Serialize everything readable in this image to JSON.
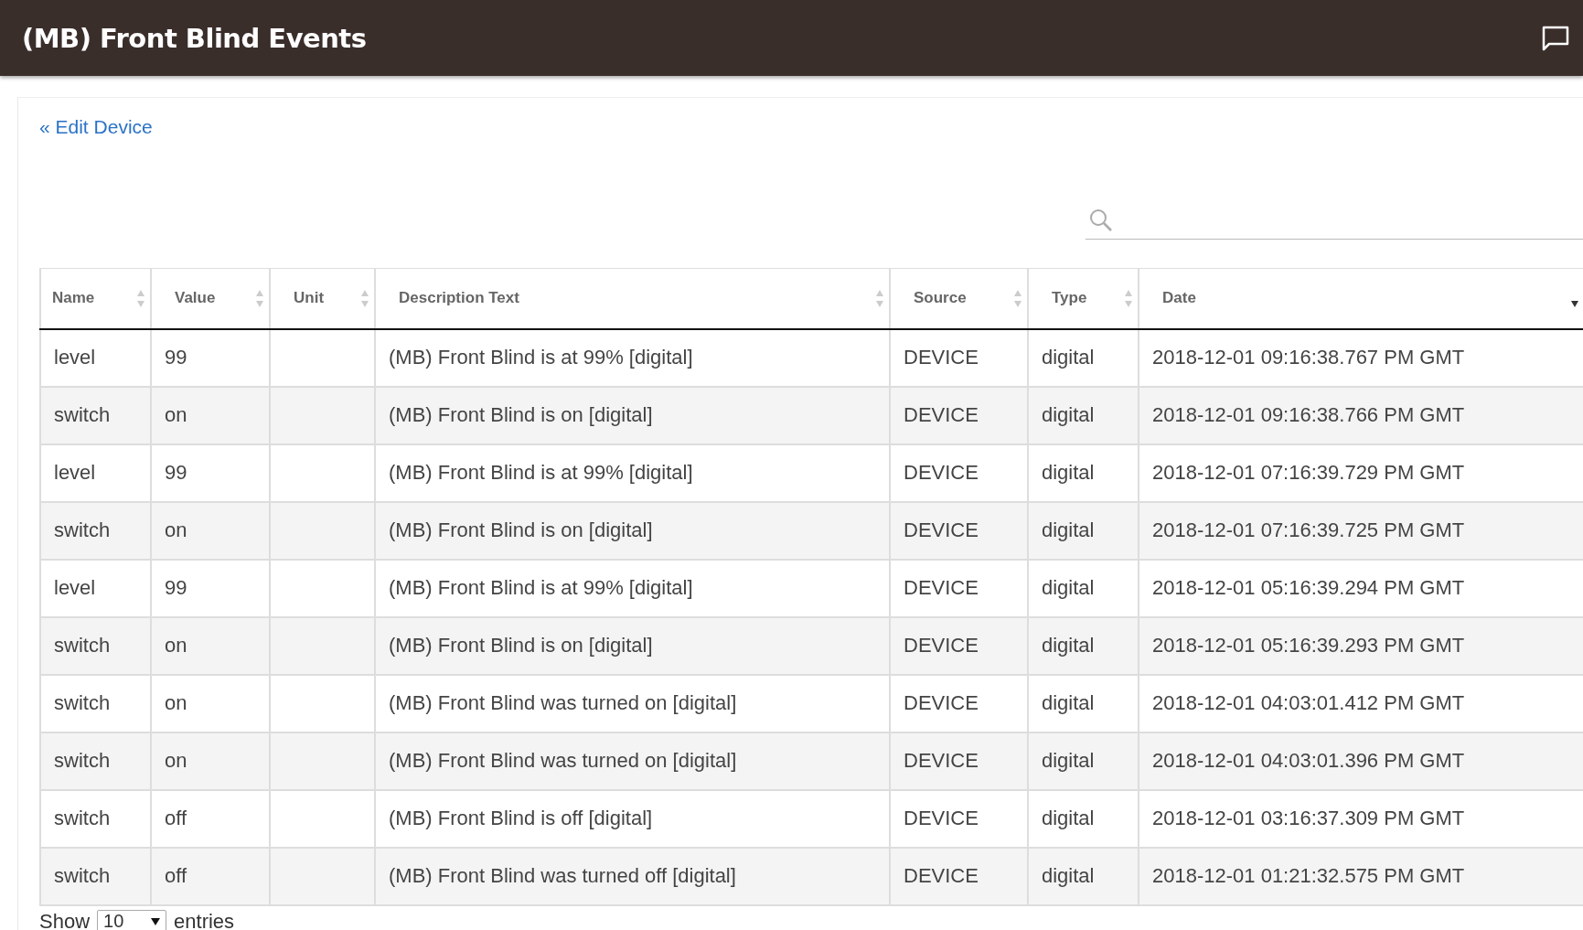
{
  "header": {
    "title": "(MB) Front Blind Events"
  },
  "back_link": "« Edit Device",
  "table": {
    "columns": [
      {
        "label": "Name",
        "sorted": false
      },
      {
        "label": "Value",
        "sorted": false
      },
      {
        "label": "Unit",
        "sorted": false
      },
      {
        "label": "Description Text",
        "sorted": false
      },
      {
        "label": "Source",
        "sorted": false
      },
      {
        "label": "Type",
        "sorted": false
      },
      {
        "label": "Date",
        "sorted": true
      }
    ],
    "rows": [
      [
        "level",
        "99",
        "",
        "(MB) Front Blind is at 99% [digital]",
        "DEVICE",
        "digital",
        "2018-12-01 09:16:38.767 PM GMT"
      ],
      [
        "switch",
        "on",
        "",
        "(MB) Front Blind is on [digital]",
        "DEVICE",
        "digital",
        "2018-12-01 09:16:38.766 PM GMT"
      ],
      [
        "level",
        "99",
        "",
        "(MB) Front Blind is at 99% [digital]",
        "DEVICE",
        "digital",
        "2018-12-01 07:16:39.729 PM GMT"
      ],
      [
        "switch",
        "on",
        "",
        "(MB) Front Blind is on [digital]",
        "DEVICE",
        "digital",
        "2018-12-01 07:16:39.725 PM GMT"
      ],
      [
        "level",
        "99",
        "",
        "(MB) Front Blind is at 99% [digital]",
        "DEVICE",
        "digital",
        "2018-12-01 05:16:39.294 PM GMT"
      ],
      [
        "switch",
        "on",
        "",
        "(MB) Front Blind is on [digital]",
        "DEVICE",
        "digital",
        "2018-12-01 05:16:39.293 PM GMT"
      ],
      [
        "switch",
        "on",
        "",
        "(MB) Front Blind was turned on [digital]",
        "DEVICE",
        "digital",
        "2018-12-01 04:03:01.412 PM GMT"
      ],
      [
        "switch",
        "on",
        "",
        "(MB) Front Blind was turned on [digital]",
        "DEVICE",
        "digital",
        "2018-12-01 04:03:01.396 PM GMT"
      ],
      [
        "switch",
        "off",
        "",
        "(MB) Front Blind is off [digital]",
        "DEVICE",
        "digital",
        "2018-12-01 03:16:37.309 PM GMT"
      ],
      [
        "switch",
        "off",
        "",
        "(MB) Front Blind was turned off [digital]",
        "DEVICE",
        "digital",
        "2018-12-01 01:21:32.575 PM GMT"
      ]
    ]
  },
  "page_length": {
    "before": "Show",
    "value": "10",
    "after": "entries"
  }
}
